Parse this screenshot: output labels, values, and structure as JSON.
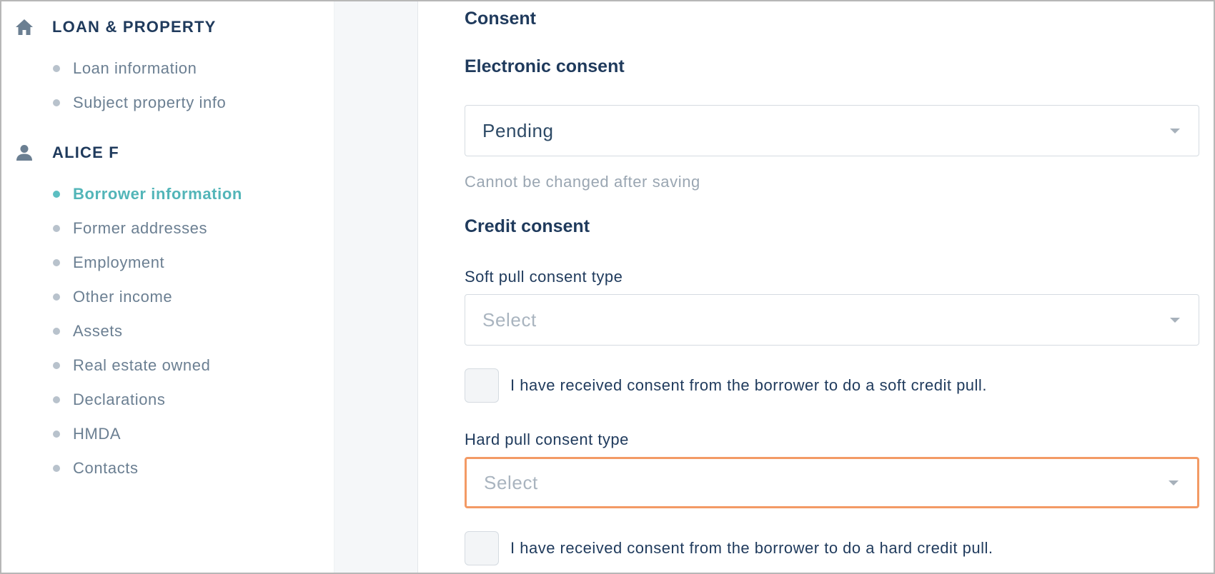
{
  "sidebar": {
    "sections": [
      {
        "title": "LOAN & PROPERTY",
        "icon": "home-icon",
        "items": [
          {
            "label": "Loan information",
            "active": false
          },
          {
            "label": "Subject property info",
            "active": false
          }
        ]
      },
      {
        "title": "ALICE F",
        "icon": "person-icon",
        "items": [
          {
            "label": "Borrower information",
            "active": true
          },
          {
            "label": "Former addresses",
            "active": false
          },
          {
            "label": "Employment",
            "active": false
          },
          {
            "label": "Other income",
            "active": false
          },
          {
            "label": "Assets",
            "active": false
          },
          {
            "label": "Real estate owned",
            "active": false
          },
          {
            "label": "Declarations",
            "active": false
          },
          {
            "label": "HMDA",
            "active": false
          },
          {
            "label": "Contacts",
            "active": false
          }
        ]
      }
    ]
  },
  "main": {
    "heading": "Consent",
    "electronic": {
      "heading": "Electronic consent",
      "value": "Pending",
      "helper": "Cannot be changed after saving"
    },
    "credit": {
      "heading": "Credit consent",
      "soft": {
        "label": "Soft pull consent type",
        "placeholder": "Select",
        "checkbox_label": "I have received consent from the borrower to do a soft credit pull."
      },
      "hard": {
        "label": "Hard pull consent type",
        "placeholder": "Select",
        "checkbox_label": "I have received consent from the borrower to do a hard credit pull."
      }
    }
  },
  "colors": {
    "accent": "#52b5b8",
    "error_border": "#f39a65",
    "heading": "#1f3a5c",
    "muted": "#6b7f92"
  }
}
